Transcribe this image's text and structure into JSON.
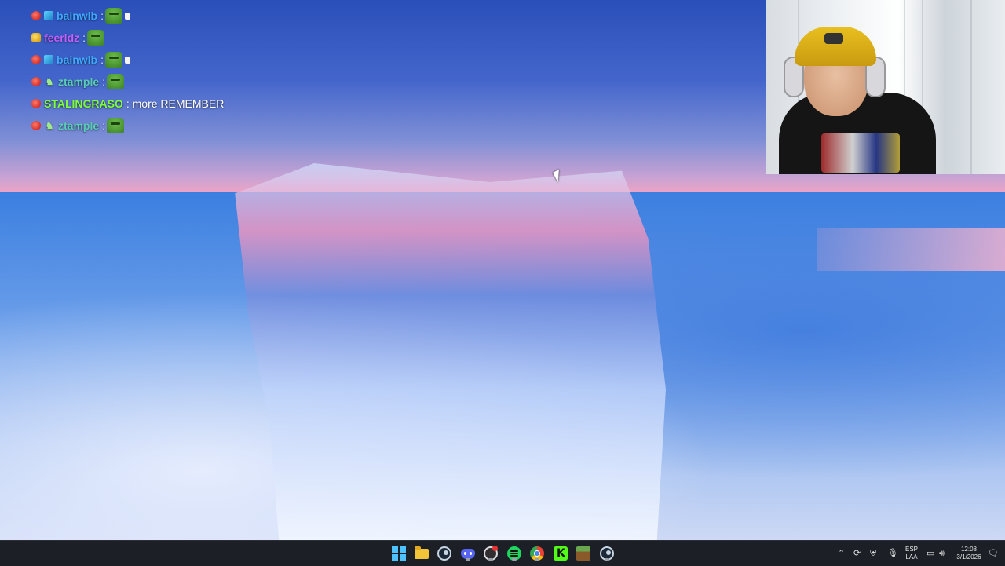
{
  "chat": {
    "messages": [
      {
        "user": "bainwlb",
        "user_color": "#3ea8ff",
        "badges": [
          "red",
          "cube"
        ],
        "text": "",
        "emote": true,
        "cup": true
      },
      {
        "user": "feerldz",
        "user_color": "#c060ff",
        "badges": [
          "yellow"
        ],
        "text": "",
        "emote": true,
        "cup": false
      },
      {
        "user": "bainwlb",
        "user_color": "#3ea8ff",
        "badges": [
          "red",
          "cube"
        ],
        "text": "",
        "emote": true,
        "cup": true
      },
      {
        "user": "ztample",
        "user_color": "#5acbb8",
        "badges": [
          "red",
          "paw"
        ],
        "text": "",
        "emote": true,
        "cup": false
      },
      {
        "user": "STALINGRASO",
        "user_color": "#7cff3a",
        "badges": [
          "red"
        ],
        "text": "more REMEMBER",
        "emote": false,
        "cup": false
      },
      {
        "user": "ztample",
        "user_color": "#5acbb8",
        "badges": [
          "red",
          "paw"
        ],
        "text": "",
        "emote": true,
        "cup": false
      }
    ]
  },
  "taskbar": {
    "apps": [
      {
        "name": "start-button",
        "icon": "windows-icon"
      },
      {
        "name": "file-explorer-button",
        "icon": "folder-icon"
      },
      {
        "name": "steam-button",
        "icon": "steam-icon"
      },
      {
        "name": "discord-button",
        "icon": "discord-icon"
      },
      {
        "name": "obs-button",
        "icon": "obs-icon"
      },
      {
        "name": "spotify-button",
        "icon": "spotify-icon"
      },
      {
        "name": "chrome-button",
        "icon": "chrome-icon"
      },
      {
        "name": "kick-button",
        "icon": "kick-icon"
      },
      {
        "name": "minecraft-button",
        "icon": "minecraft-icon"
      },
      {
        "name": "steam-button-2",
        "icon": "steam-icon"
      }
    ],
    "tray": {
      "language_line1": "ESP",
      "language_line2": "LAA",
      "time": "12:08",
      "date": "3/1/2026"
    }
  }
}
